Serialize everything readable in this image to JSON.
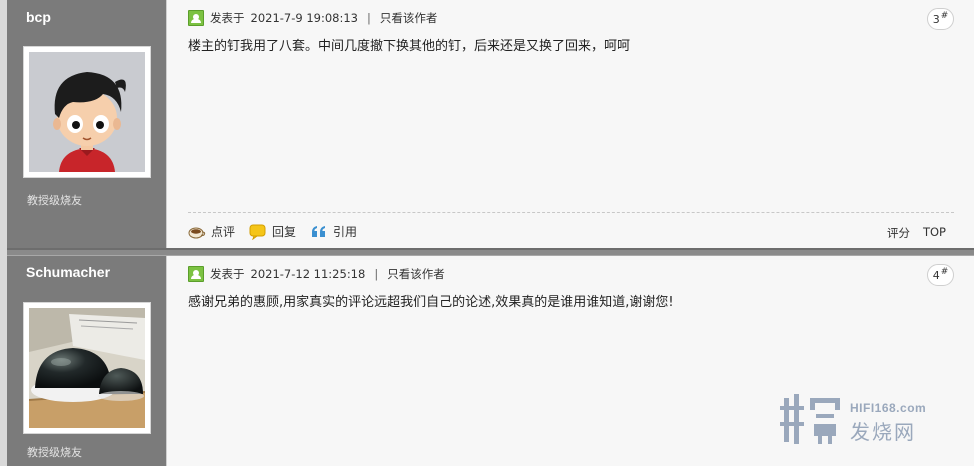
{
  "posts": [
    {
      "author": "bcp",
      "rank": "教授级烧友",
      "posted_label": "发表于",
      "posted_time": "2021-7-9 19:08:13",
      "separator": "|",
      "author_only": "只看该作者",
      "floor": "3",
      "floor_mark": "#",
      "text": "楼主的钉我用了八套。中间几度撤下换其他的钉，后来还是又换了回来，呵呵",
      "actions": [
        "点评",
        "回复",
        "引用"
      ],
      "tools": [
        "评分",
        "TOP"
      ]
    },
    {
      "author": "Schumacher",
      "rank": "教授级烧友",
      "posted_label": "发表于",
      "posted_time": "2021-7-12 11:25:18",
      "separator": "|",
      "author_only": "只看该作者",
      "floor": "4",
      "floor_mark": "#",
      "text": "感谢兄弟的惠顾,用家真实的评论远超我们自己的论述,效果真的是谁用谁知道,谢谢您!"
    }
  ],
  "watermark": {
    "url": "HIFI168.com",
    "name": "发烧网"
  },
  "colors": {
    "author_column": "#7b7b7b",
    "online_icon": "#7cc242",
    "watermark": "#9aa8bc"
  },
  "icons": {
    "comment": "coffee-cup-icon",
    "reply": "speech-bubble-icon",
    "quote": "quote-marks-icon"
  }
}
